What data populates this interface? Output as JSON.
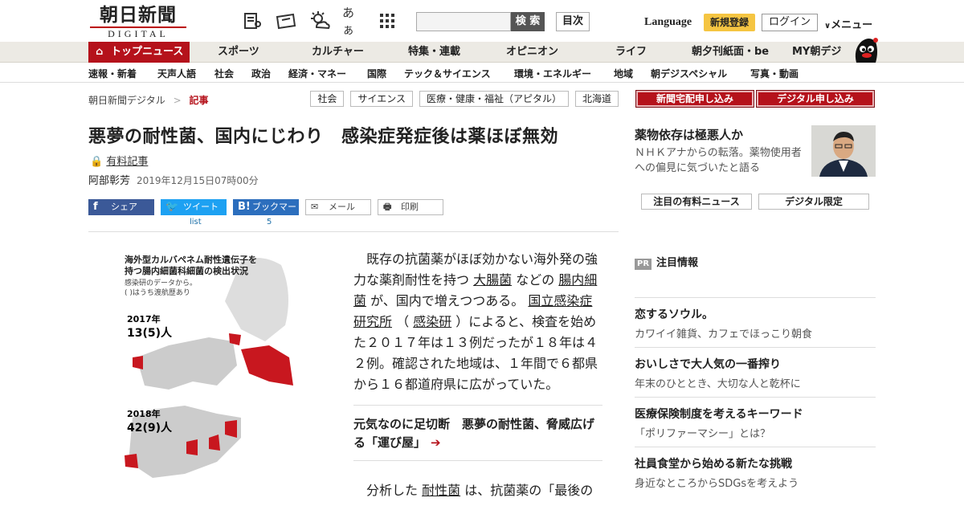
{
  "header": {
    "logo_top": "朝日新聞",
    "logo_bottom": "DIGITAL",
    "search_button": "検 索",
    "toc_button": "目次",
    "language": "Language",
    "register": "新規登録",
    "login": "ログイン",
    "menu": "メニュー",
    "icon_aa": "あぁ"
  },
  "nav_main": [
    "トップニュース",
    "スポーツ",
    "カルチャー",
    "特集・連載",
    "オピニオン",
    "ライフ",
    "朝夕刊紙面・be",
    "MY朝デジ"
  ],
  "nav_sub": [
    "速報・新着",
    "天声人語",
    "社会",
    "政治",
    "経済・マネー",
    "国際",
    "テック＆サイエンス",
    "環境・エネルギー",
    "地域",
    "朝デジスペシャル",
    "写真・動画"
  ],
  "breadcrumb": {
    "home": "朝日新聞デジタル",
    "sep": ">",
    "current": "記事"
  },
  "tags": [
    "社会",
    "サイエンス",
    "医療・健康・福祉（アピタル）",
    "北海道"
  ],
  "article": {
    "title": "悪夢の耐性菌、国内にじわり　感染症発症後は薬ほぼ無効",
    "paid": "有料記事",
    "author": "阿部彰芳",
    "date": "2019年12月15日07時00分",
    "share": {
      "facebook": "シェア",
      "twitter": "ツイート",
      "hatena": "ブックマーク",
      "mail": "メール",
      "print": "印刷",
      "twitter_count": "list",
      "hatena_count": "5"
    },
    "map": {
      "title1": "海外型カルバペネム耐性遺伝子を",
      "title2": "持つ腸内細菌科細菌の検出状況",
      "note1": "感染研のデータから。",
      "note2": "(  )はうち渡航歴あり",
      "y2017": "2017年",
      "y2017v": "13(5)人",
      "y2018": "2018年",
      "y2018v": "42(9)人"
    },
    "para1": [
      {
        "t": "　既存の抗菌薬がほぼ効かない海外発の強力な薬剤耐性を持つ "
      },
      {
        "t": "大腸菌",
        "u": true
      },
      {
        "t": " などの "
      },
      {
        "t": "腸内細菌",
        "u": true
      },
      {
        "t": " が、国内で増えつつある。 "
      },
      {
        "t": "国立感染症研究所",
        "u": true
      },
      {
        "t": " （ "
      },
      {
        "t": "感染研",
        "u": true
      },
      {
        "t": " ）によると、検査を始めた２０１７年は１３例だったが１８年は４２例。確認された地域は、１年間で６都県から１６都道府県に広がっていた。"
      }
    ],
    "related": "元気なのに足切断　悪夢の耐性菌、脅威広げる「運び屋」",
    "para2_a": "　分析した ",
    "para2_u": "耐性菌",
    "para2_b": " は、抗菌薬の「最後の"
  },
  "sidebar": {
    "subscribe_paper": "新聞宅配申し込み",
    "subscribe_digital": "デジタル申し込み",
    "feature_title": "薬物依存は極悪人か",
    "feature_desc": "ＮＨＫアナからの転落。薬物使用者への偏見に気づいたと語る",
    "btn_news": "注目の有料ニュース",
    "btn_digital": "デジタル限定",
    "pr_badge": "PR",
    "pr_heading": "注目情報",
    "items": [
      {
        "title": "恋するソウル。",
        "desc": "カワイイ雑貨、カフェでほっこり朝食"
      },
      {
        "title": "おいしさで大人気の一番搾り",
        "desc": "年末のひととき、大切な人と乾杯に"
      },
      {
        "title": "医療保険制度を考えるキーワード",
        "desc": "「ポリファーマシー」とは？"
      },
      {
        "title": "社員食堂から始める新たな挑戦",
        "desc": "身近なところからSDGsを考えよう"
      }
    ]
  }
}
